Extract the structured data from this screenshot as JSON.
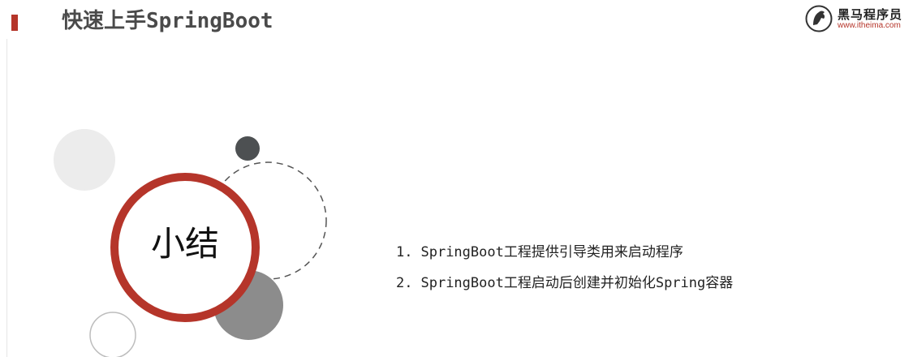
{
  "header": {
    "title": "快速上手SpringBoot",
    "accent_color": "#b5352a"
  },
  "logo": {
    "name": "黑马程序员",
    "url": "www.itheima.com",
    "icon": "horse-head-icon"
  },
  "summary": {
    "title": "小结",
    "points": [
      {
        "num": "1.",
        "text": "SpringBoot工程提供引导类用来启动程序"
      },
      {
        "num": "2.",
        "text": "SpringBoot工程启动后创建并初始化Spring容器"
      }
    ]
  },
  "colors": {
    "ring": "#b5352a",
    "dark_dot": "#4d5052",
    "gray_circle": "#8c8c8c",
    "light_circle": "#ececec"
  }
}
